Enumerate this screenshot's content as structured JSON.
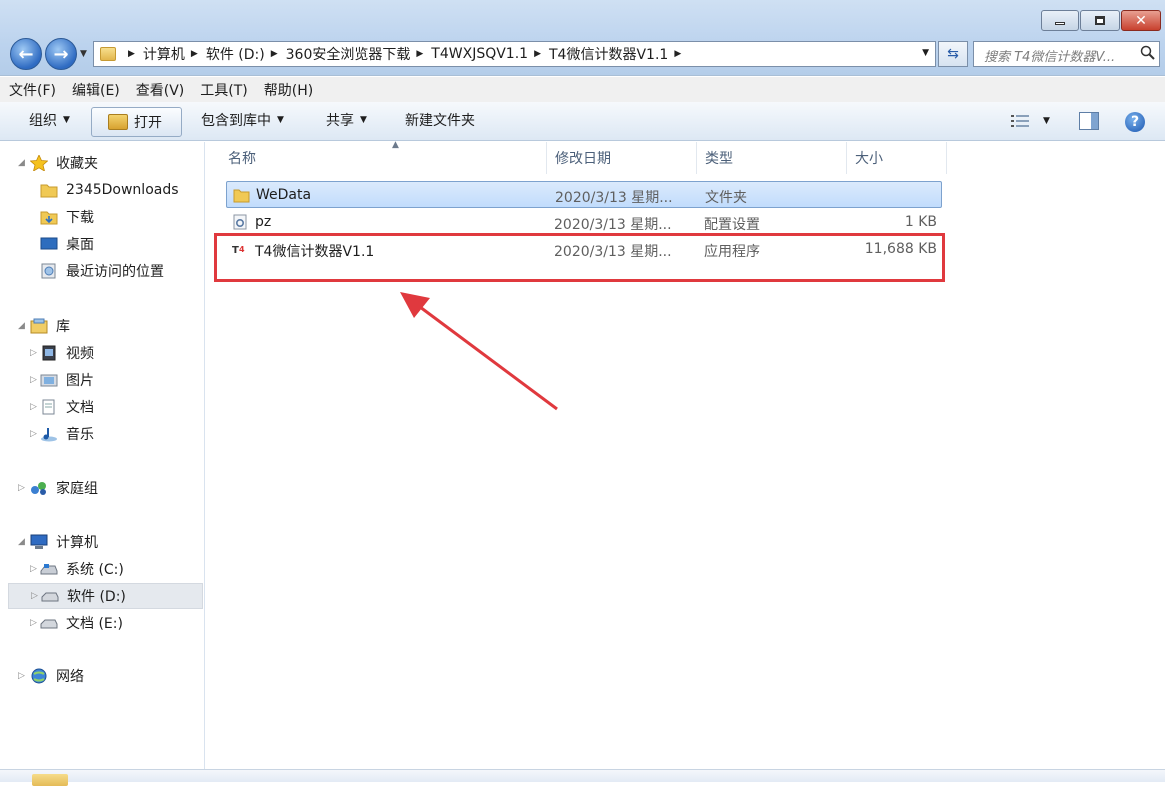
{
  "window": {
    "minimize_icon": "minimize-icon",
    "maximize_icon": "maximize-icon",
    "close_icon": "close-icon"
  },
  "address_bar": {
    "breadcrumbs": [
      "计算机",
      "软件 (D:)",
      "360安全浏览器下载",
      "T4WXJSQV1.1",
      "T4微信计数器V1.1"
    ]
  },
  "search": {
    "placeholder": "搜索 T4微信计数器V..."
  },
  "menu": [
    "文件(F)",
    "编辑(E)",
    "查看(V)",
    "工具(T)",
    "帮助(H)"
  ],
  "toolbar": {
    "organize": "组织",
    "open": "打开",
    "include_in_library": "包含到库中",
    "share": "共享",
    "new_folder": "新建文件夹"
  },
  "nav": {
    "favorites": "收藏夹",
    "favorites_items": [
      "2345Downloads",
      "下载",
      "桌面",
      "最近访问的位置"
    ],
    "libraries": "库",
    "library_items": [
      "视频",
      "图片",
      "文档",
      "音乐"
    ],
    "homegroup": "家庭组",
    "computer": "计算机",
    "drives": [
      "系统 (C:)",
      "软件 (D:)",
      "文档 (E:)"
    ],
    "selected_drive": "软件 (D:)",
    "network": "网络"
  },
  "columns": {
    "name": "名称",
    "date": "修改日期",
    "type": "类型",
    "size": "大小"
  },
  "files": [
    {
      "name": "WeData",
      "date": "2020/3/13 星期...",
      "type": "文件夹",
      "size": "",
      "icon": "folder-icon",
      "selected": true
    },
    {
      "name": "pz",
      "date": "2020/3/13 星期...",
      "type": "配置设置",
      "size": "1 KB",
      "icon": "config-file-icon",
      "selected": false
    },
    {
      "name": "T4微信计数器V1.1",
      "date": "2020/3/13 星期...",
      "type": "应用程序",
      "size": "11,688 KB",
      "icon": "app-icon",
      "selected": false
    }
  ],
  "annotation": {
    "highlight_color": "#e0393e",
    "arrow_color": "#e0393e"
  }
}
